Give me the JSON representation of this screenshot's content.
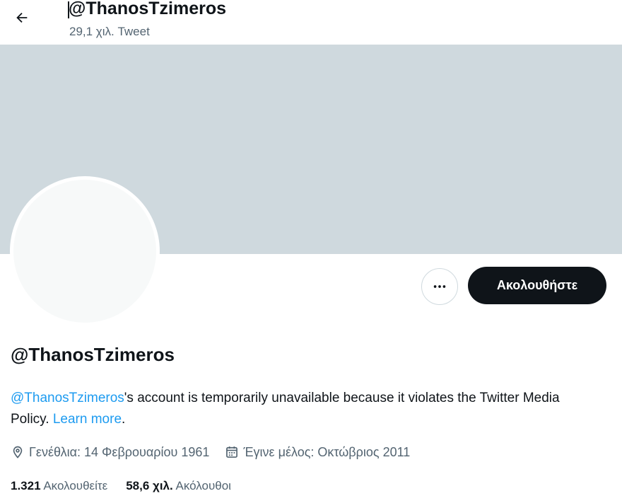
{
  "header": {
    "handle": "@ThanosTzimeros",
    "tweet_count": "29,1 χιλ. Tweet",
    "back_icon": "arrow-left-icon"
  },
  "profile": {
    "handle": "@ThanosTzimeros",
    "notice": {
      "handle_link": "@ThanosTzimeros",
      "text": "'s account is temporarily unavailable because it violates the Twitter Media Policy. ",
      "learn_more": "Learn more",
      "end": "."
    },
    "birthday": "Γενέθλια: 14 Φεβρουαρίου 1961",
    "joined": "Έγινε μέλος: Οκτώβριος 2011",
    "following_count": "1.321",
    "following_label": "Ακολουθείτε",
    "followers_count": "58,6 χιλ.",
    "followers_label": "Ακόλουθοι"
  },
  "actions": {
    "more_icon": "more-horizontal-icon",
    "follow_label": "Ακολουθήστε"
  },
  "colors": {
    "banner": "#cfd9de",
    "link": "#1d9bf0",
    "follow_button_bg": "#0f1419",
    "secondary_text": "#536471"
  }
}
